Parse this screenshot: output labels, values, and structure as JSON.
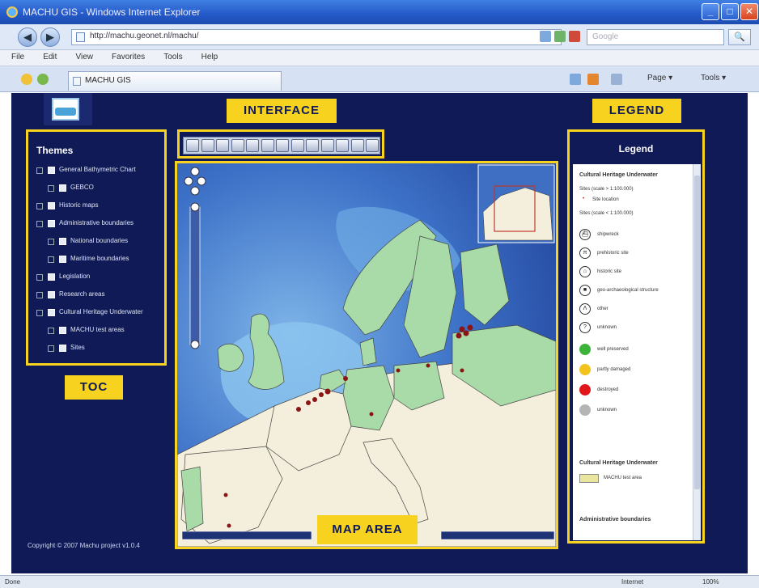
{
  "window": {
    "title": "MACHU GIS - Windows Internet Explorer",
    "controls": [
      "_",
      "□",
      "✕"
    ]
  },
  "browser": {
    "url": "http://machu.geonet.nl/machu/",
    "search_placeholder": "Google",
    "search_go": "🔍",
    "menu": [
      "File",
      "Edit",
      "View",
      "Favorites",
      "Tools",
      "Help"
    ],
    "tab_title": "MACHU GIS",
    "commands": {
      "page": "Page ▾",
      "tools": "Tools ▾"
    },
    "status_left": "Done",
    "status_zone": "Internet",
    "status_zoom": "100%"
  },
  "callouts": {
    "interface": "INTERFACE",
    "legend": "LEGEND",
    "toc": "TOC",
    "map_area": "MAP AREA"
  },
  "toc": {
    "title": "Themes",
    "items": [
      {
        "label": "General Bathymetric Chart",
        "indent": 0
      },
      {
        "label": "GEBCO",
        "indent": 1
      },
      {
        "label": "Historic maps",
        "indent": 0
      },
      {
        "label": "Administrative boundaries",
        "indent": 0
      },
      {
        "label": "National boundaries",
        "indent": 1
      },
      {
        "label": "Maritime boundaries",
        "indent": 1
      },
      {
        "label": "Legislation",
        "indent": 0
      },
      {
        "label": "Research areas",
        "indent": 0
      },
      {
        "label": "Cultural Heritage Underwater",
        "indent": 0
      },
      {
        "label": "MACHU test areas",
        "indent": 1
      },
      {
        "label": "Sites",
        "indent": 1
      }
    ]
  },
  "copyright": "Copyright © 2007 Machu project v1.0.4",
  "legend": {
    "title": "Legend",
    "section1": "Cultural Heritage Underwater",
    "sites_scale_a": "Sites (scale > 1:100.000)",
    "site_location": "Site location",
    "sites_scale_b": "Sites (scale < 1:100.000)",
    "symbols": [
      {
        "glyph": "⛴",
        "label": "shipwreck"
      },
      {
        "glyph": "π",
        "label": "prehistoric site"
      },
      {
        "glyph": "⌂",
        "label": "historic site"
      },
      {
        "glyph": "■",
        "label": "geo-archaeological structure"
      },
      {
        "glyph": "Λ",
        "label": "other"
      },
      {
        "glyph": "?",
        "label": "unknown"
      }
    ],
    "states": [
      {
        "color": "#3cb43a",
        "label": "well preserved"
      },
      {
        "color": "#f2c31c",
        "label": "partly damaged"
      },
      {
        "color": "#e0161c",
        "label": "destroyed"
      },
      {
        "color": "#b5b5b5",
        "label": "unknown"
      }
    ],
    "section2": "Cultural Heritage Underwater",
    "test_area": "MACHU test area",
    "section3": "Administrative boundaries"
  },
  "colors": {
    "app_bg": "#0f1a56",
    "callout": "#f7d21e",
    "land": "#a8dba8",
    "land_other": "#f4efdc",
    "sea_deep": "#2b58b8",
    "sea_shallow": "#7fb5e8",
    "site_marker": "#8b1414"
  }
}
